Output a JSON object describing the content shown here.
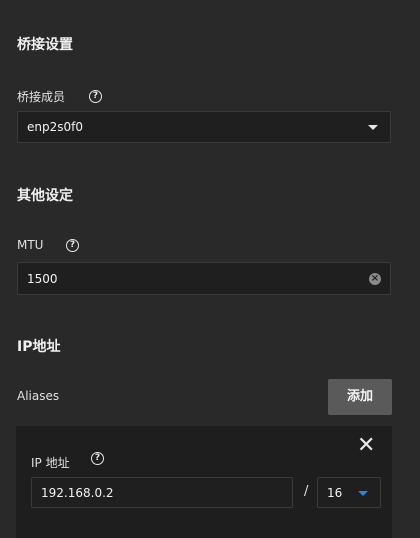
{
  "bridge_settings": {
    "title": "桥接设置",
    "members_label": "桥接成员",
    "members_value": "enp2s0f0"
  },
  "other_settings": {
    "title": "其他设定",
    "mtu_label": "MTU",
    "mtu_value": "1500"
  },
  "ip_section": {
    "title": "IP地址",
    "aliases_label": "Aliases",
    "add_button": "添加",
    "alias_card": {
      "ip_label": "IP 地址",
      "ip_value": "192.168.0.2",
      "separator": "/",
      "netmask_value": "16"
    }
  },
  "icons": {
    "help": "?",
    "clear": "×",
    "close": "✕"
  },
  "colors": {
    "background": "#292929",
    "field_bg": "#1f1f1f",
    "button_bg": "#5a5a5a",
    "accent": "#1e88e5"
  }
}
